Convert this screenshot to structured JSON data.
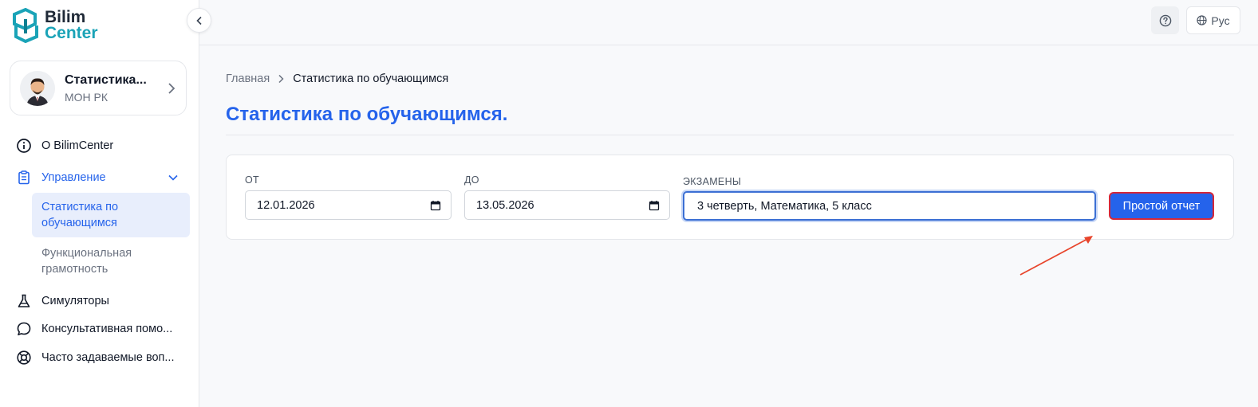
{
  "brand": {
    "line1": "Bilim",
    "line2": "Center"
  },
  "profile": {
    "name": "Статистика...",
    "org": "МОН РК"
  },
  "nav": {
    "about": "О BilimCenter",
    "management": "Управление",
    "sub": {
      "student_stats": "Статистика по обучающимся",
      "functional_literacy": "Функциональная грамотность"
    },
    "simulators": "Симуляторы",
    "consult": "Консультативная помо...",
    "faq": "Часто задаваемые воп..."
  },
  "header": {
    "lang": "Рус"
  },
  "breadcrumb": {
    "home": "Главная",
    "current": "Статистика по обучающимся"
  },
  "page_title": "Статистика по обучающимся.",
  "filters": {
    "from_label": "ОТ",
    "from_value": "12.01.2026",
    "to_label": "ДО",
    "to_value": "13.05.2026",
    "exams_label": "ЭКЗАМЕНЫ",
    "exams_value": "3 четверть, Математика, 5 класс",
    "report_button": "Простой отчет"
  },
  "colors": {
    "accent": "#2563eb",
    "brand_teal": "#1aa3b7",
    "annotation": "#e8452c"
  }
}
